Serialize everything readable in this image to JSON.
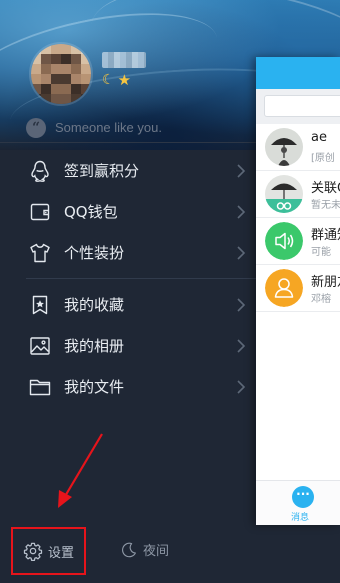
{
  "profile": {
    "signature": "Someone like you.",
    "badges": [
      "moon-icon",
      "star-icon"
    ]
  },
  "menu": {
    "group1": [
      {
        "label": "签到赢积分",
        "icon": "penguin-icon"
      },
      {
        "label": "QQ钱包",
        "icon": "wallet-icon"
      },
      {
        "label": "个性装扮",
        "icon": "tshirt-icon"
      }
    ],
    "group2": [
      {
        "label": "我的收藏",
        "icon": "bookmark-star-icon"
      },
      {
        "label": "我的相册",
        "icon": "photo-icon"
      },
      {
        "label": "我的文件",
        "icon": "folder-icon"
      }
    ]
  },
  "bottom": {
    "settings_label": "设置",
    "night_label": "夜间"
  },
  "chat_panel": {
    "rows": [
      {
        "name": "ae",
        "msg": "[原创",
        "avatar": "umbrella-person-icon"
      },
      {
        "name": "关联Q",
        "msg": "暂无未",
        "avatar": "umbrella-link-icon"
      },
      {
        "name": "群通知",
        "msg": "可能",
        "avatar": "speaker-icon"
      },
      {
        "name": "新朋友",
        "msg": "邓榕",
        "avatar": "person-icon"
      }
    ],
    "footer_tab": "消息"
  },
  "colors": {
    "background": "#1f2735",
    "accent_blue": "#2ab2f0",
    "highlight_red": "#e6141b",
    "speaker_green": "#3bc86b",
    "newfriend_orange": "#f6a623"
  }
}
